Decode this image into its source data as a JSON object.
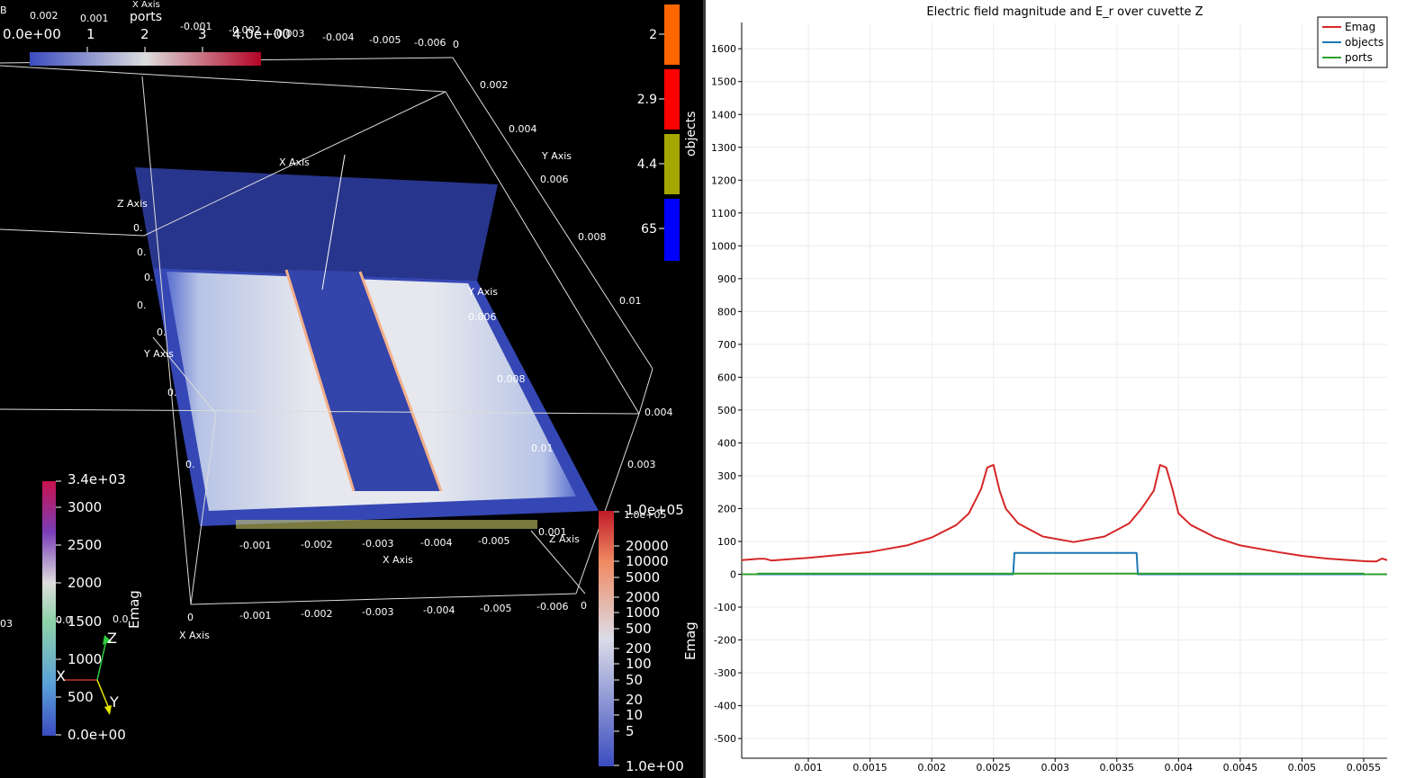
{
  "render_view": {
    "ports_bar": {
      "title": "ports",
      "min_label": "0.0e+00",
      "max_label": "4.0e+00",
      "ticks": [
        "1",
        "2",
        "3"
      ],
      "colors": {
        "low": "#3b4cc0",
        "mid": "#dddddd",
        "high": "#b40426"
      }
    },
    "objects_legend": {
      "title": "objects",
      "entries": [
        {
          "label": "2",
          "color": "#ff6600"
        },
        {
          "label": "2.9",
          "color": "#ff0000"
        },
        {
          "label": "4.4",
          "color": "#a6a600"
        },
        {
          "label": "65",
          "color": "#0000ff"
        }
      ]
    },
    "emag_bar_left": {
      "title": "Emag",
      "max_label": "3.4e+03",
      "ticks": [
        "3000",
        "2500",
        "2000",
        "1500",
        "1000",
        "500"
      ],
      "min_label": "0.0e+00"
    },
    "emag_bar_log": {
      "title": "Emag",
      "max_label": "1.0e+05",
      "ticks": [
        "20000",
        "10000",
        "5000",
        "2000",
        "1000",
        "500",
        "200",
        "100",
        "50",
        "20",
        "10",
        "5"
      ],
      "min_label": "1.0e+00"
    },
    "axes_grid": {
      "axis_title_x": "X Axis",
      "axis_title_y": "Y Axis",
      "axis_title_z": "Z Axis",
      "top_x_ticks": [
        "0.002",
        "0.001",
        "-0.001",
        "-0.002",
        "-0.003",
        "-0.004",
        "-0.005",
        "-0.006",
        "0"
      ],
      "right_y_ticks": [
        "0.002",
        "0.004",
        "0.006",
        "0.008",
        "0.01"
      ],
      "inner_y_ticks": [
        "0.006",
        "0.008",
        "0.01"
      ],
      "right_z_ticks": [
        "0.004",
        "0.003"
      ],
      "bottom_x_ticks": [
        "0",
        "-0.001",
        "-0.002",
        "-0.003",
        "-0.004",
        "-0.005",
        "-0.006",
        "0"
      ],
      "inner_x_ticks": [
        "-0.001",
        "-0.002",
        "-0.003",
        "-0.004",
        "-0.005",
        "0.001"
      ],
      "partial_labels": [
        "B",
        "0.",
        "0.",
        "0.",
        "0.",
        "0.",
        "0.",
        "0.",
        "03",
        "0.0",
        "0.0"
      ],
      "clipped_unit_label": "1.0e+05"
    },
    "orientation": {
      "x": "X",
      "y": "Y",
      "z": "Z"
    }
  },
  "chart_view": {
    "title": "Electric field magnitude and E_r over cuvette Z",
    "legend": [
      "Emag",
      "objects",
      "ports"
    ]
  },
  "chart_data": {
    "type": "line",
    "title": "Electric field magnitude and E_r over cuvette Z",
    "xlabel": "",
    "ylabel": "",
    "xlim": [
      0.00046,
      0.00569
    ],
    "ylim": [
      -560,
      1680
    ],
    "x_ticks": [
      0.001,
      0.0015,
      0.002,
      0.0025,
      0.003,
      0.0035,
      0.004,
      0.0045,
      0.005,
      0.0055
    ],
    "x_tick_labels": [
      "0.001",
      "0.0015",
      "0.002",
      "0.0025",
      "0.003",
      "0.0035",
      "0.004",
      "0.0045",
      "0.005",
      "0.0055"
    ],
    "y_ticks": [
      -500,
      -400,
      -300,
      -200,
      -100,
      0,
      100,
      200,
      300,
      400,
      500,
      600,
      700,
      800,
      900,
      1000,
      1100,
      1200,
      1300,
      1400,
      1500,
      1600
    ],
    "y_tick_labels": [
      "-500",
      "-400",
      "-300",
      "-200",
      "-100",
      "0",
      "100",
      "200",
      "300",
      "400",
      "500",
      "600",
      "700",
      "800",
      "900",
      "1000",
      "1100",
      "1200",
      "1300",
      "1400",
      "1500",
      "1600"
    ],
    "grid": true,
    "legend_position": "top-right",
    "series": [
      {
        "name": "Emag",
        "color": "#d62728",
        "x": [
          0.00046,
          0.0006,
          0.00065,
          0.0007,
          0.001,
          0.0015,
          0.0018,
          0.002,
          0.0022,
          0.0023,
          0.0024,
          0.00245,
          0.0025,
          0.00255,
          0.0026,
          0.0027,
          0.0029,
          0.00315,
          0.0034,
          0.0036,
          0.0037,
          0.0038,
          0.00385,
          0.0039,
          0.00395,
          0.004,
          0.0041,
          0.0043,
          0.0045,
          0.0048,
          0.005,
          0.0052,
          0.0055,
          0.0056,
          0.00565,
          0.00569
        ],
        "y": [
          43,
          47,
          47,
          42,
          50,
          68,
          88,
          112,
          150,
          185,
          260,
          325,
          333,
          255,
          200,
          155,
          115,
          98,
          115,
          155,
          200,
          255,
          333,
          325,
          260,
          185,
          150,
          112,
          88,
          68,
          56,
          48,
          40,
          39,
          48,
          43
        ]
      },
      {
        "name": "objects",
        "color": "#1f77b4",
        "x": [
          0.00046,
          0.00266,
          0.00267,
          0.00366,
          0.00367,
          0.00569
        ],
        "y": [
          0,
          0,
          65,
          65,
          0,
          0
        ]
      },
      {
        "name": "ports",
        "color": "#2ca02c",
        "x": [
          0.00046,
          0.00059,
          0.00059,
          0.0055,
          0.0055,
          0.00569
        ],
        "y": [
          0,
          0,
          2,
          2,
          0,
          0
        ]
      }
    ]
  }
}
